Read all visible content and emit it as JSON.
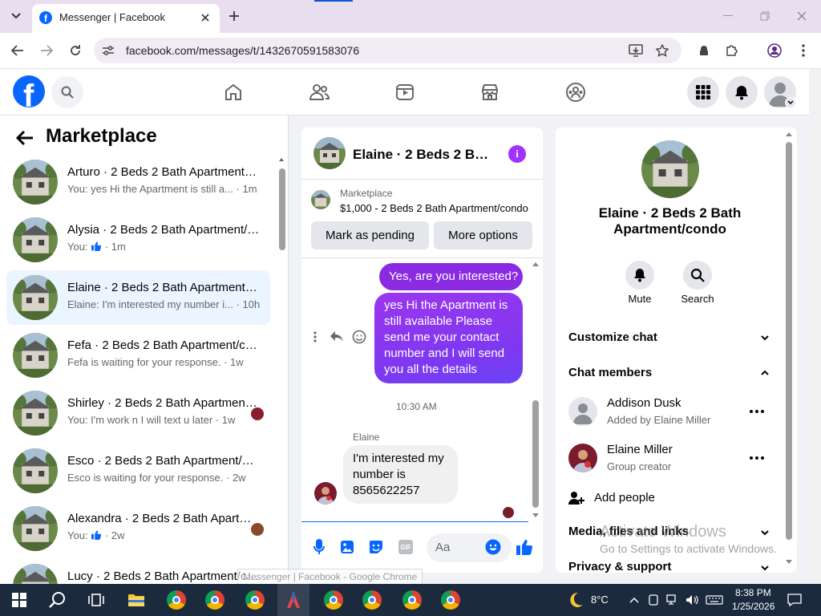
{
  "browser": {
    "tab_title": "Messenger | Facebook",
    "url": "facebook.com/messages/t/1432670591583076",
    "icons": [
      "tab-search-icon",
      "new-tab-icon",
      "back-icon",
      "forward-icon",
      "reload-icon",
      "site-info-icon",
      "install-icon",
      "bookmark-star-icon",
      "extension-icon",
      "profile-icon",
      "menu-icon"
    ]
  },
  "fb_header": {
    "nav_icons": [
      "home-icon",
      "friends-icon",
      "watch-icon",
      "marketplace-icon",
      "groups-icon"
    ]
  },
  "left": {
    "title": "Marketplace",
    "conversations": [
      {
        "title": "Arturo · 2 Beds 2 Bath Apartment/condo",
        "preview": "You: yes Hi the Apartment is still a...",
        "time": "· 1m",
        "selected": false
      },
      {
        "title": "Alysia · 2 Beds 2 Bath Apartment/condo",
        "preview": "You:",
        "time": "· 1m",
        "selected": false
      },
      {
        "title": "Elaine · 2 Beds 2 Bath Apartment/condo",
        "preview": "Elaine: I'm interested my number i...",
        "time": "· 10h",
        "selected": true
      },
      {
        "title": "Fefa · 2 Beds 2 Bath Apartment/condo",
        "preview": "Fefa is waiting for your response.",
        "time": "· 1w",
        "selected": false
      },
      {
        "title": "Shirley · 2 Beds 2 Bath Apartment/condo",
        "preview": "You: I'm work n I will text u later",
        "time": "· 1w",
        "selected": false
      },
      {
        "title": "Esco · 2 Beds 2 Bath Apartment/condo",
        "preview": "Esco is waiting for your response.",
        "time": "· 2w",
        "selected": false
      },
      {
        "title": "Alexandra · 2 Beds 2 Bath Apartment/condo",
        "preview": "You:",
        "time": "· 2w",
        "selected": false
      },
      {
        "title": "Lucy · 2 Beds 2 Bath Apartment/condo",
        "preview": "",
        "time": "",
        "selected": false
      }
    ]
  },
  "chat": {
    "header_title": "Elaine · 2 Beds 2 Bath Apartment/condo",
    "listing_label": "Marketplace",
    "listing_title": "$1,000 - 2 Beds 2 Bath Apartment/condo",
    "mark_pending": "Mark as pending",
    "more_options": "More options",
    "msg1": "Yes, are you interested?",
    "msg2": "yes Hi the Apartment is still available Please send me your contact number and I will send you all the details",
    "timestamp": "10:30 AM",
    "sender_name": "Elaine",
    "msg3": "I'm interested my number is 8565622257",
    "input_placeholder": "Aa"
  },
  "info": {
    "name": "Elaine · 2 Beds 2 Bath Apartment/condo",
    "mute": "Mute",
    "search": "Search",
    "customize": "Customize chat",
    "members_header": "Chat members",
    "members": [
      {
        "name": "Addison Dusk",
        "sub": "Added by Elaine Miller"
      },
      {
        "name": "Elaine Miller",
        "sub": "Group creator"
      }
    ],
    "add_people": "Add people",
    "media": "Media, files and links",
    "privacy": "Privacy & support"
  },
  "watermark": {
    "line1": "Activate Windows",
    "line2": "Go to Settings to activate Windows."
  },
  "tooltip": "Messenger | Facebook - Google Chrome",
  "taskbar": {
    "weather": "8°C",
    "time": "8:38 PM",
    "date": "1/25/2026"
  },
  "colors": {
    "fb_blue": "#0866ff",
    "messenger_purple": "#8a2be2",
    "selected_row": "#ebf5ff"
  }
}
